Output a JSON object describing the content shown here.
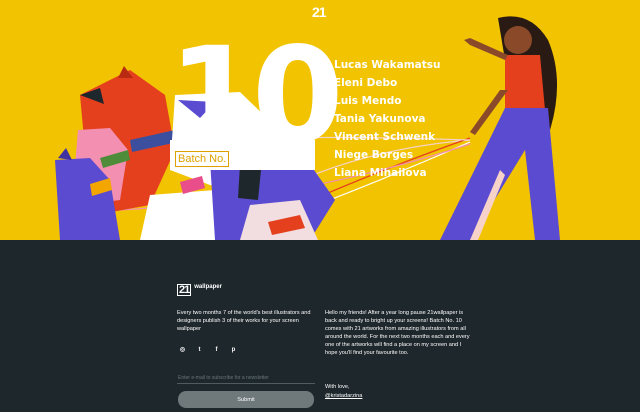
{
  "header": {
    "logo_text": "21"
  },
  "hero": {
    "number": "10",
    "batch_label": "Batch No.",
    "artists": [
      "Lucas Wakamatsu",
      "Eleni Debo",
      "Luis Mendo",
      "Tania Yakunova",
      "Vincent Schwenk",
      "Niege Borges",
      "Liana Mihailova"
    ],
    "colors": {
      "background": "#f2c300",
      "accent_red": "#e4401e",
      "accent_purple": "#5b4bd1"
    }
  },
  "footer": {
    "brand": {
      "mark": "21",
      "name": "wallpaper"
    },
    "description": "Every two months 7 of the world's best illustrators and designers publish 3 of their works for your screen wallpaper",
    "socials": [
      {
        "name": "instagram-icon",
        "glyph": "◎"
      },
      {
        "name": "twitter-icon",
        "glyph": "t"
      },
      {
        "name": "facebook-icon",
        "glyph": "f"
      },
      {
        "name": "pinterest-icon",
        "glyph": "p"
      }
    ],
    "newsletter": {
      "placeholder": "Enter e-mail to subscribe for a newsletter",
      "value": "",
      "submit_label": "Submit"
    },
    "letter": "Hello my friends! After a year long pause 21wallpaper is back and ready to bright up your screens! Batch No. 10 comes with 21 artworks from amazing illustrators from all around the world. For the next two months each and every one of the artworks will find a place on my screen and I hope you'll find your favourite too.",
    "signoff": "With love,",
    "handle": "@kristadarzina",
    "colors": {
      "background": "#1e272c",
      "button": "#6f787b"
    }
  }
}
